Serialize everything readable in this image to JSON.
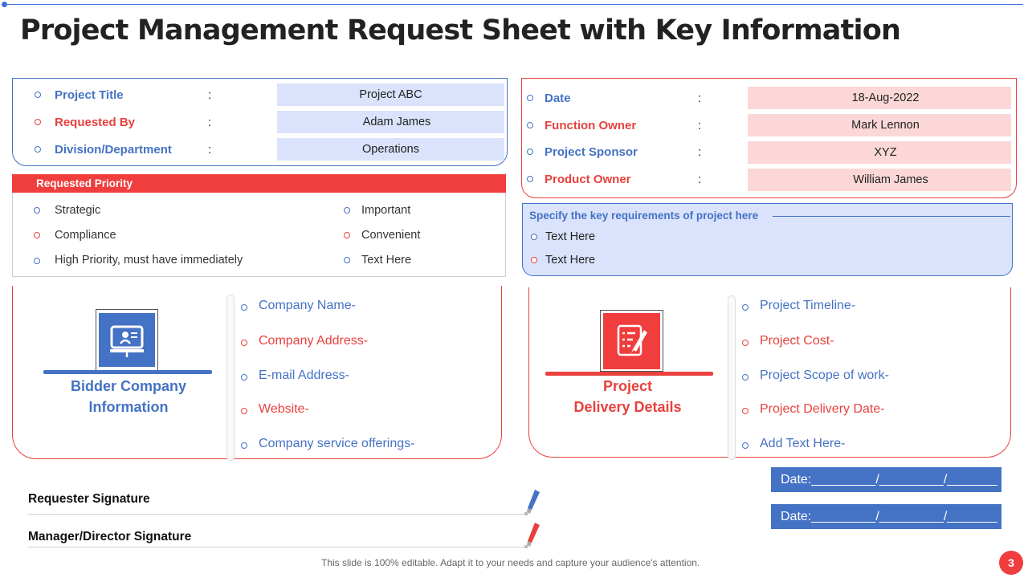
{
  "title": "Project Management Request Sheet with Key Information",
  "key_info_left": [
    {
      "label": "Project Title",
      "value": "Project ABC",
      "color": "blue"
    },
    {
      "label": "Requested By",
      "value": "Adam James",
      "color": "red"
    },
    {
      "label": "Division/Department",
      "value": "Operations",
      "color": "blue"
    }
  ],
  "key_info_right": [
    {
      "label": "Date",
      "value": "18-Aug-2022",
      "color": "blue"
    },
    {
      "label": "Function Owner",
      "value": "Mark Lennon",
      "color": "red"
    },
    {
      "label": "Project Sponsor",
      "value": "XYZ",
      "color": "blue"
    },
    {
      "label": "Product Owner",
      "value": "William James",
      "color": "red"
    }
  ],
  "colon": ":",
  "priority": {
    "header": "Requested Priority",
    "left_items": [
      "Strategic",
      "Compliance",
      "High Priority, must have immediately"
    ],
    "right_items": [
      "Important",
      "Convenient",
      "Text Here"
    ]
  },
  "requirements": {
    "title": "Specify the key requirements of project here",
    "items": [
      "Text Here",
      "Text Here"
    ]
  },
  "bidder": {
    "heading_line1": "Bidder Company",
    "heading_line2": "Information",
    "icon": "computer-presentation-icon",
    "fields": [
      "Company Name-",
      "Company Address-",
      "E-mail Address-",
      "Website-",
      "Company service offerings-"
    ]
  },
  "delivery": {
    "heading_line1": "Project",
    "heading_line2": "Delivery Details",
    "icon": "checklist-pen-icon",
    "fields": [
      "Project Timeline-",
      "Project Cost-",
      "Project Scope of work-",
      "Project Delivery Date-",
      "Add Text Here-"
    ]
  },
  "signatures": {
    "requester": "Requester Signature",
    "manager": "Manager/Director Signature"
  },
  "dates": [
    "Date:_________/_________/_______",
    "Date:_________/_________/_______"
  ],
  "footer": "This slide is 100% editable. Adapt it to your needs and capture your audience's attention.",
  "page_number": "3",
  "colors": {
    "blue": "#4472c4",
    "red": "#e8413d",
    "light_blue": "#dae3fb",
    "light_red": "#fcd7d7"
  }
}
